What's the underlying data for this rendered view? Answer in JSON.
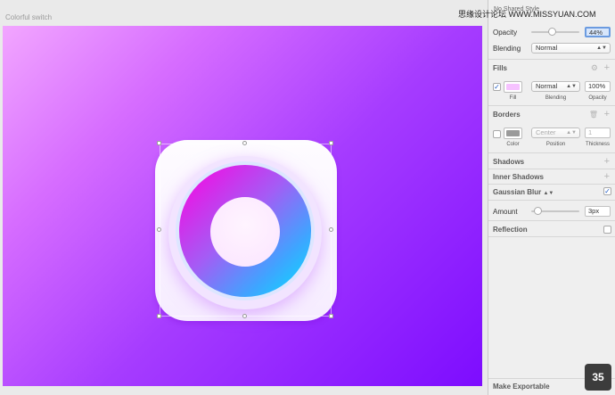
{
  "canvas": {
    "artboard_label": "Colorful switch"
  },
  "inspector": {
    "shared_style": "No Shared Style",
    "opacity": {
      "label": "Opacity",
      "value": "44%",
      "level": 0.44
    },
    "blending": {
      "label": "Blending",
      "value": "Normal"
    },
    "fills": {
      "title": "Fills",
      "enabled": true,
      "swatch_color": "#f6c2ff",
      "blending_value": "Normal",
      "opacity_value": "100%",
      "sub_fill": "Fill",
      "sub_blending": "Blending",
      "sub_opacity": "Opacity"
    },
    "borders": {
      "title": "Borders",
      "enabled": false,
      "swatch_color": "#9a9a9a",
      "position_value": "Center",
      "thickness_value": "1",
      "sub_color": "Color",
      "sub_position": "Position",
      "sub_thickness": "Thickness"
    },
    "shadows": {
      "title": "Shadows"
    },
    "inner_shadows": {
      "title": "Inner Shadows"
    },
    "gaussian_blur": {
      "title": "Gaussian Blur",
      "enabled": true
    },
    "amount": {
      "label": "Amount",
      "value": "3px",
      "level": 0.05
    },
    "reflection": {
      "title": "Reflection",
      "enabled": false
    },
    "make_exportable": "Make Exportable"
  },
  "badge": {
    "number": "35"
  },
  "watermark": {
    "text": "思缘设计论坛 WWW.MISSYUAN.COM"
  },
  "colors": {
    "accent": "#1e59c4",
    "artboard_gradient_start": "#f2a6ff",
    "artboard_gradient_end": "#7d0cff"
  },
  "icons": [
    "gear-icon",
    "trash-icon",
    "plus-icon",
    "checkmark-icon",
    "stepper-arrows-icon"
  ]
}
